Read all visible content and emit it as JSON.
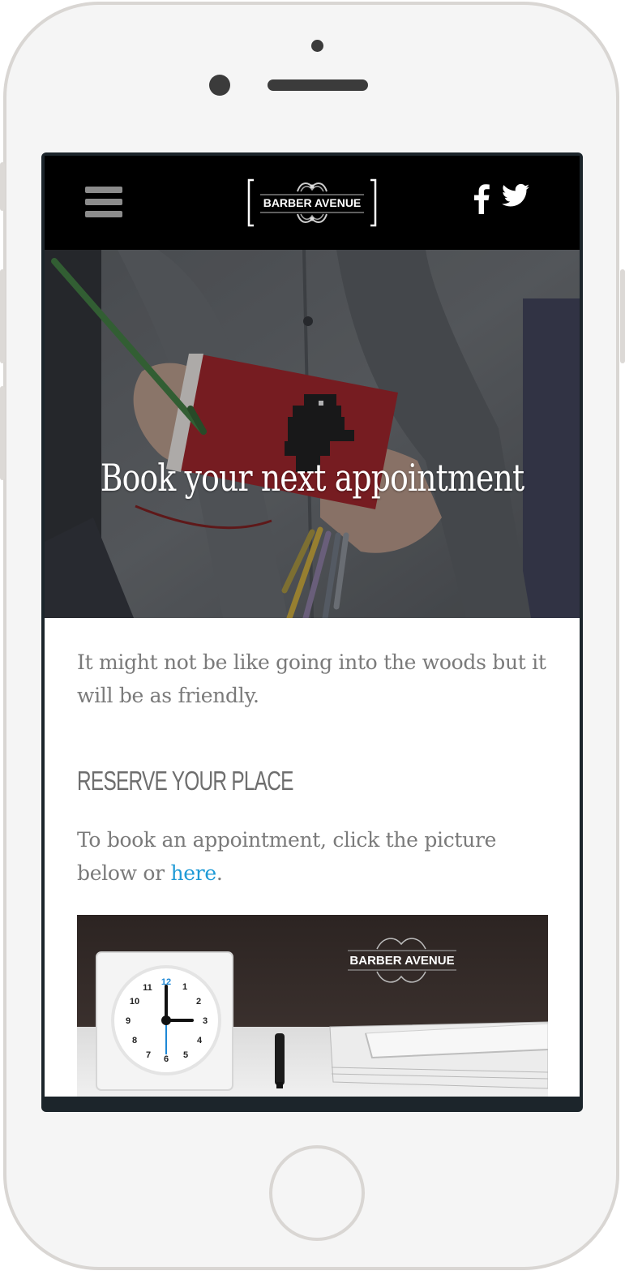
{
  "header": {
    "menu_icon": "hamburger-menu-icon",
    "logo_text": "BARBER AVENUE",
    "social": [
      "facebook-icon",
      "twitter-icon"
    ]
  },
  "hero": {
    "title": "Book your next appointment"
  },
  "content": {
    "intro": "It might not be like going into the woods but it will be as friendly.",
    "subheading": "RESERVE YOUR PLACE",
    "booking_text": "To book an appointment, click the picture below or ",
    "booking_link": "here",
    "booking_end": "."
  },
  "booking_image": {
    "logo_text": "BARBER AVENUE",
    "clock_numbers": [
      "12",
      "1",
      "2",
      "3",
      "4",
      "5",
      "6",
      "7",
      "8",
      "9",
      "10",
      "11"
    ]
  },
  "colors": {
    "header_bg": "#000000",
    "text": "#7a7a7a",
    "link": "#1e9ad6",
    "frame": "#1c252b"
  }
}
